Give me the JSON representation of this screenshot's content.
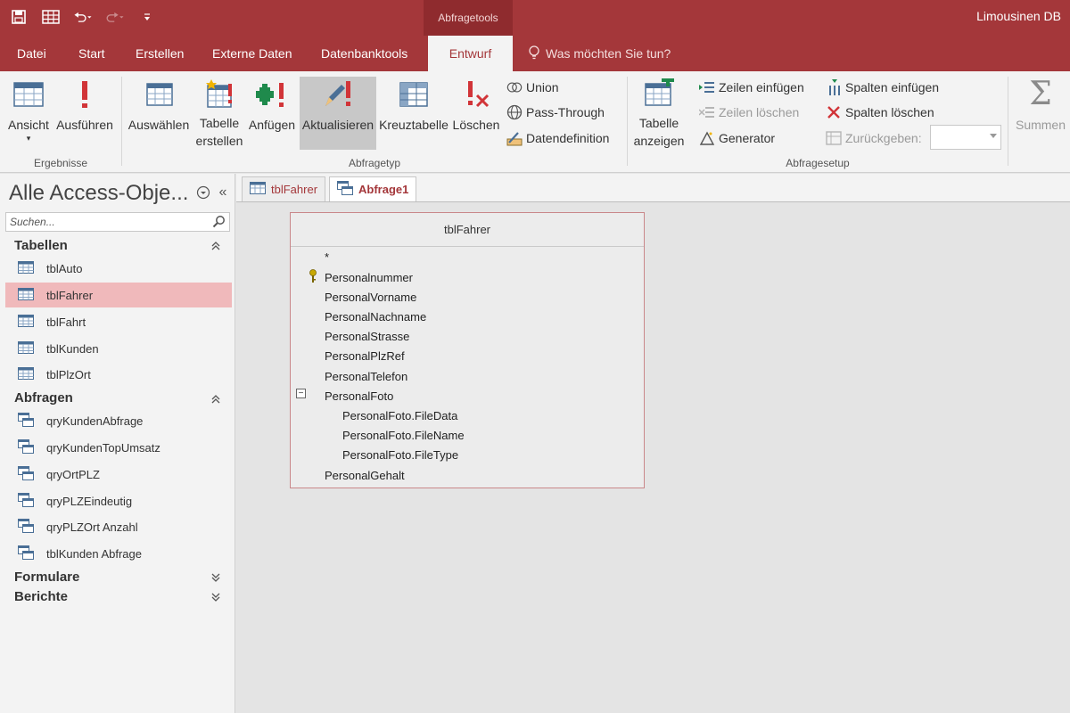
{
  "app": {
    "title": "Limousinen DB",
    "context_tab": "Abfragetools"
  },
  "ribbon_tabs": [
    {
      "label": "Datei"
    },
    {
      "label": "Start"
    },
    {
      "label": "Erstellen"
    },
    {
      "label": "Externe Daten"
    },
    {
      "label": "Datenbanktools"
    },
    {
      "label": "Entwurf",
      "active": true
    }
  ],
  "tell_me": "Was möchten Sie tun?",
  "ribbon": {
    "groups": {
      "ergebnisse": "Ergebnisse",
      "abfragetyp": "Abfragetyp",
      "abfragesetup": "Abfragesetup"
    },
    "ansicht": "Ansicht",
    "ausfuehren": "Ausführen",
    "auswaehlen": "Auswählen",
    "tabelle_erstellen_1": "Tabelle",
    "tabelle_erstellen_2": "erstellen",
    "anfuegen": "Anfügen",
    "aktualisieren": "Aktualisieren",
    "kreuztabelle": "Kreuztabelle",
    "loeschen": "Löschen",
    "union": "Union",
    "pass_through": "Pass-Through",
    "datendefinition": "Datendefinition",
    "tabelle_anzeigen_1": "Tabelle",
    "tabelle_anzeigen_2": "anzeigen",
    "zeilen_einfuegen": "Zeilen einfügen",
    "zeilen_loeschen": "Zeilen löschen",
    "generator": "Generator",
    "spalten_einfuegen": "Spalten einfügen",
    "spalten_loeschen": "Spalten löschen",
    "zurueckgeben": "Zurückgeben:",
    "summen": "Summen"
  },
  "nav": {
    "title": "Alle Access-Obje...",
    "search_placeholder": "Suchen...",
    "sections": {
      "tabellen": "Tabellen",
      "abfragen": "Abfragen",
      "formulare": "Formulare",
      "berichte": "Berichte"
    },
    "tables": [
      "tblAuto",
      "tblFahrer",
      "tblFahrt",
      "tblKunden",
      "tblPlzOrt"
    ],
    "queries": [
      "qryKundenAbfrage",
      "qryKundenTopUmsatz",
      "qryOrtPLZ",
      "qryPLZEindeutig",
      "qryPLZOrt Anzahl",
      "tblKunden Abfrage"
    ]
  },
  "doc_tabs": [
    "tblFahrer",
    "Abfrage1"
  ],
  "field_list": {
    "table": "tblFahrer",
    "fields": [
      "*",
      "Personalnummer",
      "PersonalVorname",
      "PersonalNachname",
      "PersonalStrasse",
      "PersonalPlzRef",
      "PersonalTelefon",
      "PersonalFoto",
      "PersonalFoto.FileData",
      "PersonalFoto.FileName",
      "PersonalFoto.FileType",
      "PersonalGehalt"
    ]
  },
  "colors": {
    "accent": "#a4373a",
    "selected": "#f0b9bb"
  }
}
